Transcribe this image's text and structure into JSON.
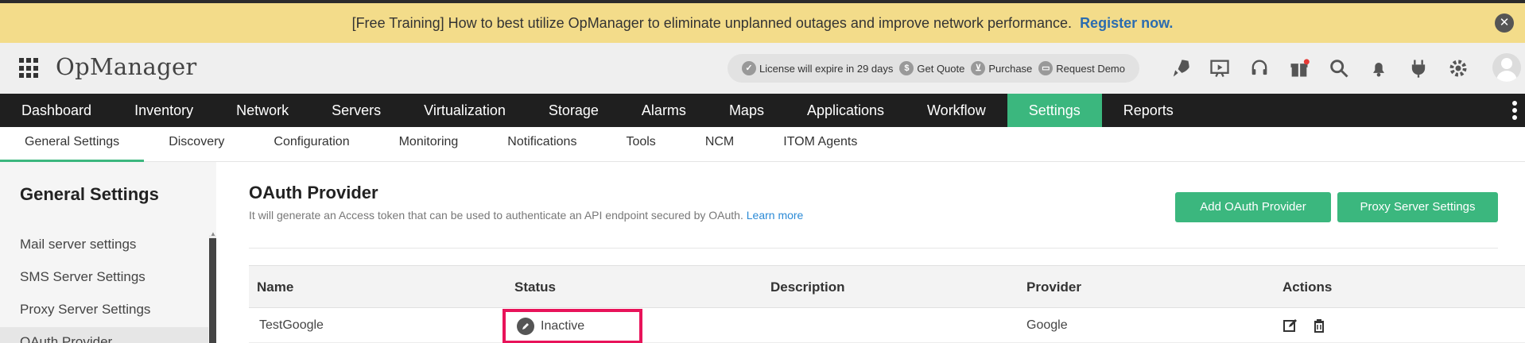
{
  "banner": {
    "text": "[Free Training] How to best utilize OpManager to eliminate unplanned outages and improve network performance.",
    "link": "Register now.",
    "close_glyph": "✕"
  },
  "header": {
    "app_title": "OpManager",
    "license": "License will expire in 29 days",
    "get_quote": "Get Quote",
    "purchase": "Purchase",
    "request_demo": "Request Demo"
  },
  "main_nav": [
    "Dashboard",
    "Inventory",
    "Network",
    "Servers",
    "Virtualization",
    "Storage",
    "Alarms",
    "Maps",
    "Applications",
    "Workflow",
    "Settings",
    "Reports"
  ],
  "main_nav_active": "Settings",
  "sub_nav": [
    "General Settings",
    "Discovery",
    "Configuration",
    "Monitoring",
    "Notifications",
    "Tools",
    "NCM",
    "ITOM Agents"
  ],
  "sub_nav_active": "General Settings",
  "sidebar": {
    "title": "General Settings",
    "items": [
      "Mail server settings",
      "SMS Server Settings",
      "Proxy Server Settings",
      "OAuth Provider"
    ]
  },
  "content": {
    "title": "OAuth Provider",
    "description": "It will generate an Access token that can be used to authenticate an API endpoint secured by OAuth.",
    "learn_more": "Learn more",
    "add_button": "Add OAuth Provider",
    "proxy_button": "Proxy Server Settings"
  },
  "table": {
    "headers": [
      "Name",
      "Status",
      "Description",
      "Provider",
      "Actions"
    ],
    "rows": [
      {
        "name": "TestGoogle",
        "status": "Inactive",
        "description": "",
        "provider": "Google"
      }
    ]
  },
  "colors": {
    "accent": "#3bb77e",
    "banner": "#f3dc8a",
    "nav": "#1f1f1f",
    "highlight": "#e8135a"
  }
}
